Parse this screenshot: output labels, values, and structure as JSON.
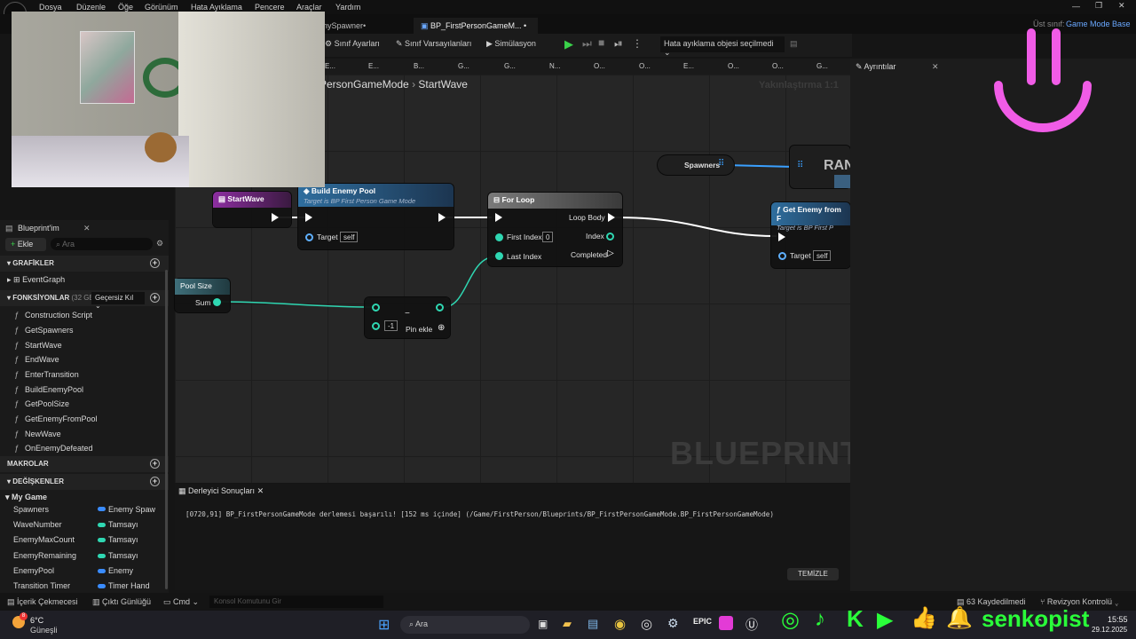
{
  "menu": {
    "items": [
      "Dosya",
      "Düzenle",
      "Öğe",
      "Görünüm",
      "Hata Ayıklama",
      "Pencere",
      "Araçlar",
      "Yardım"
    ]
  },
  "tabs": {
    "prev": "nySpawner•",
    "active": "BP_FirstPersonGameM... •",
    "parent_label": "Üst sınıf:",
    "parent_value": "Game Mode Base"
  },
  "toolbar": {
    "class_settings": "Sınıf Ayarları",
    "class_defaults": "Sınıf Varsayılanları",
    "simulation": "Simülasyon",
    "debug_object": "Hata ayıklama objesi seçilmedi"
  },
  "fn_tabs": [
    "E...",
    "E...",
    "B...",
    "G...",
    "G...",
    "N...",
    "O...",
    "O...",
    "E...",
    "O...",
    "O...",
    "G..."
  ],
  "details": {
    "title": "Ayrıntılar"
  },
  "graph": {
    "breadcrumb": "PersonGameMode",
    "current": "StartWave",
    "zoom": "Yakınlaştırma 1:1",
    "watermark": "BLUEPRINT"
  },
  "nodes": {
    "startwave": {
      "title": "StartWave"
    },
    "build_pool": {
      "title": "Build Enemy Pool",
      "subtitle": "Target is BP First Person Game Mode",
      "target_label": "Target",
      "target_value": "self"
    },
    "for_loop": {
      "title": "For Loop",
      "first_index": "First Index",
      "first_index_value": "0",
      "last_index": "Last Index",
      "loop_body": "Loop Body",
      "index": "Index",
      "completed": "Completed"
    },
    "spawners": {
      "label": "Spawners"
    },
    "random": {
      "title": "RAN"
    },
    "get_enemy": {
      "title": "Get Enemy from F",
      "subtitle": "Target is BP First P",
      "target_label": "Target",
      "target_value": "self"
    },
    "pool_size": {
      "title": "Pool Size",
      "sum": "Sum"
    },
    "subtract": {
      "value": "-1",
      "add_pin": "Pin ekle"
    }
  },
  "left_panel": {
    "title": "Blueprint'im",
    "add": "Ekle",
    "search_placeholder": "Ara",
    "graphs_header": "GRAFİKLER",
    "event_graph": "EventGraph",
    "functions_header": "FONKSİYONLAR",
    "functions_count": "(32 GEÇE",
    "override": "Geçersiz Kıl",
    "functions": [
      "Construction Script",
      "GetSpawners",
      "StartWave",
      "EndWave",
      "EnterTransition",
      "BuildEnemyPool",
      "GetPoolSize",
      "GetEnemyFromPool",
      "NewWave",
      "OnEnemyDefeated"
    ],
    "macros_header": "MAKROLAR",
    "variables_header": "DEĞİŞKENLER",
    "my_game": "My Game",
    "variables": [
      {
        "name": "Spawners",
        "type": "Enemy Spaw",
        "color": "#3a8cff"
      },
      {
        "name": "WaveNumber",
        "type": "Tamsayı",
        "color": "#2fd7b2"
      },
      {
        "name": "EnemyMaxCount",
        "type": "Tamsayı",
        "color": "#2fd7b2"
      },
      {
        "name": "EnemyRemaining",
        "type": "Tamsayı",
        "color": "#2fd7b2"
      },
      {
        "name": "EnemyPool",
        "type": "Enemy",
        "color": "#3a8cff"
      },
      {
        "name": "Transition Timer",
        "type": "Timer Hand",
        "color": "#3a8cff"
      }
    ]
  },
  "output": {
    "tab": "Derleyici Sonuçları",
    "message": "[0720,91] BP_FirstPersonGameMode derlemesi başarılı! [152 ms içinde] (/Game/FirstPerson/Blueprints/BP_FirstPersonGameMode.BP_FirstPersonGameMode)",
    "clear": "TEMİZLE"
  },
  "statusbar": {
    "content_drawer": "İçerik Çekmecesi",
    "output_log": "Çıktı Günlüğü",
    "cmd": "Cmd",
    "console_placeholder": "Konsol Komutunu Gir",
    "saved": "63 Kaydedilmedi",
    "revision": "Revizyon Kontrolü"
  },
  "taskbar": {
    "temp": "6°C",
    "weather": "Güneşli",
    "search": "Ara",
    "time": "15:55",
    "date": "29.12.2025",
    "badge": "8"
  },
  "overlay": {
    "channel": "senkopist"
  }
}
